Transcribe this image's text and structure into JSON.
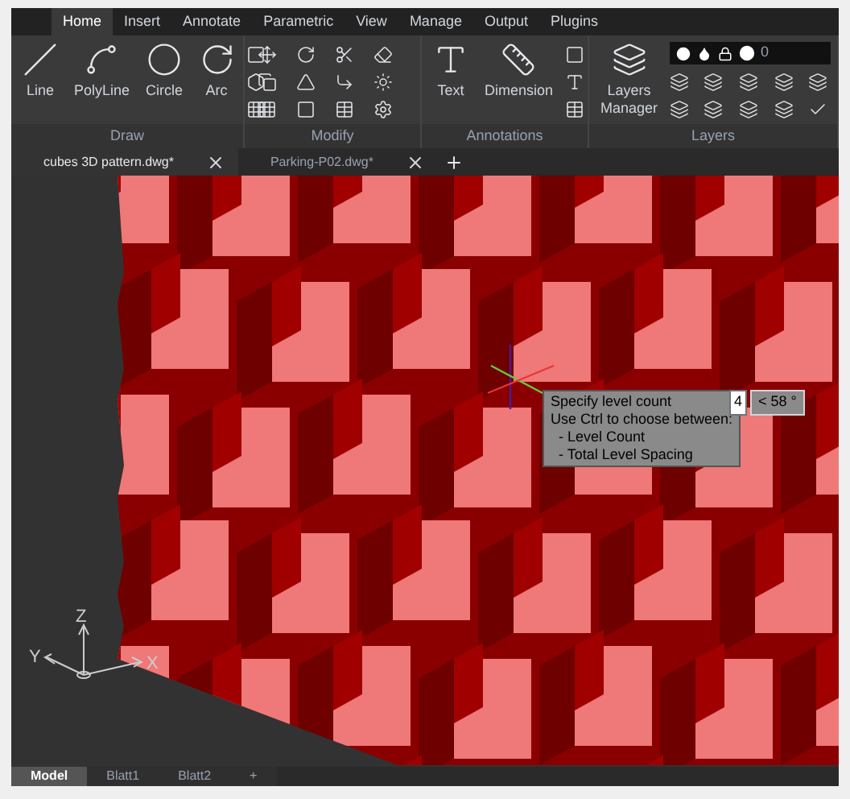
{
  "ribbon_tabs": [
    {
      "label": "Home",
      "selected": true
    },
    {
      "label": "Insert",
      "selected": false
    },
    {
      "label": "Annotate",
      "selected": false
    },
    {
      "label": "Parametric",
      "selected": false
    },
    {
      "label": "View",
      "selected": false
    },
    {
      "label": "Manage",
      "selected": false
    },
    {
      "label": "Output",
      "selected": false
    },
    {
      "label": "Plugins",
      "selected": false
    }
  ],
  "panels": [
    {
      "kind": "draw",
      "title": "Draw",
      "tools": [
        "Line",
        "PolyLine",
        "Circle",
        "Arc"
      ]
    },
    {
      "kind": "modify",
      "title": "Modify"
    },
    {
      "kind": "annotations",
      "title": "Annotations",
      "tools": [
        "Text",
        "Dimension"
      ]
    },
    {
      "kind": "layers",
      "title": "Layers",
      "tools": [
        "Layers Manager"
      ],
      "current_layer": "0"
    }
  ],
  "doc_tabs": [
    {
      "label": "cubes 3D pattern.dwg*",
      "selected": true
    },
    {
      "label": "Parking-P02.dwg*",
      "selected": false
    }
  ],
  "tooltip": {
    "lines": [
      "Specify level count",
      "Use Ctrl to choose between:",
      "  - Level Count",
      "  - Total Level Spacing"
    ],
    "input_value": "4",
    "angle": "< 58 °"
  },
  "ucs": {
    "x": "X",
    "y": "Y",
    "z": "Z"
  },
  "layout_tabs": [
    {
      "label": "Model",
      "selected": true
    },
    {
      "label": "Blatt1",
      "selected": false
    },
    {
      "label": "Blatt2",
      "selected": false
    },
    {
      "label": "+",
      "selected": false
    }
  ]
}
